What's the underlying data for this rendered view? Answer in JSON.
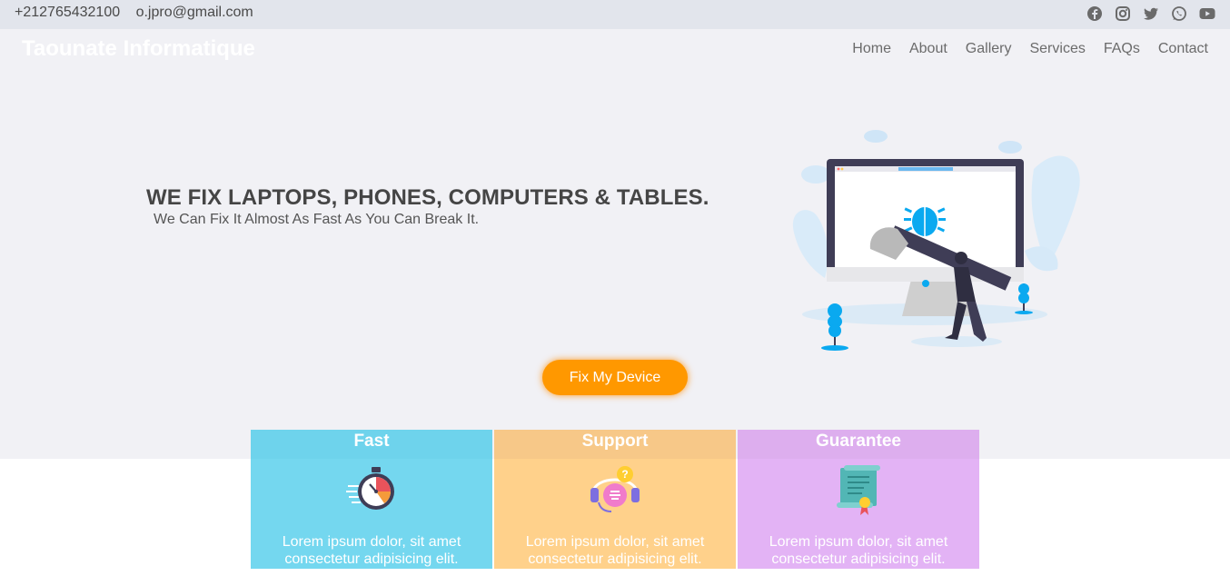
{
  "topbar": {
    "phone": "+212765432100",
    "email": "o.jpro@gmail.com",
    "social": [
      "facebook-icon",
      "instagram-icon",
      "twitter-icon",
      "whatsapp-icon",
      "youtube-icon"
    ]
  },
  "brand": "Taounate Informatique",
  "nav": [
    "Home",
    "About",
    "Gallery",
    "Services",
    "FAQs",
    "Contact"
  ],
  "hero": {
    "headline": "WE FIX LAPTOPS, PHONES, COMPUTERS & TABLES.",
    "subline": "We Can Fix It Almost As Fast As You Can Break It.",
    "cta": "Fix My Device"
  },
  "cards": [
    {
      "title": "Fast",
      "icon": "stopwatch-icon",
      "text": "Lorem ipsum dolor, sit amet consectetur adipisicing elit."
    },
    {
      "title": "Support",
      "icon": "headset-support-icon",
      "text": "Lorem ipsum dolor, sit amet consectetur adipisicing elit."
    },
    {
      "title": "Guarantee",
      "icon": "certificate-icon",
      "text": "Lorem ipsum dolor, sit amet consectetur adipisicing elit."
    }
  ],
  "colors": {
    "topbar_bg": "#e2e5ec",
    "hero_bg": "#f1f1f5",
    "cta": "#ff9800",
    "card_fast": "#74d7ef",
    "card_support": "#ffd18b",
    "card_guarantee": "#e3b3f5"
  }
}
